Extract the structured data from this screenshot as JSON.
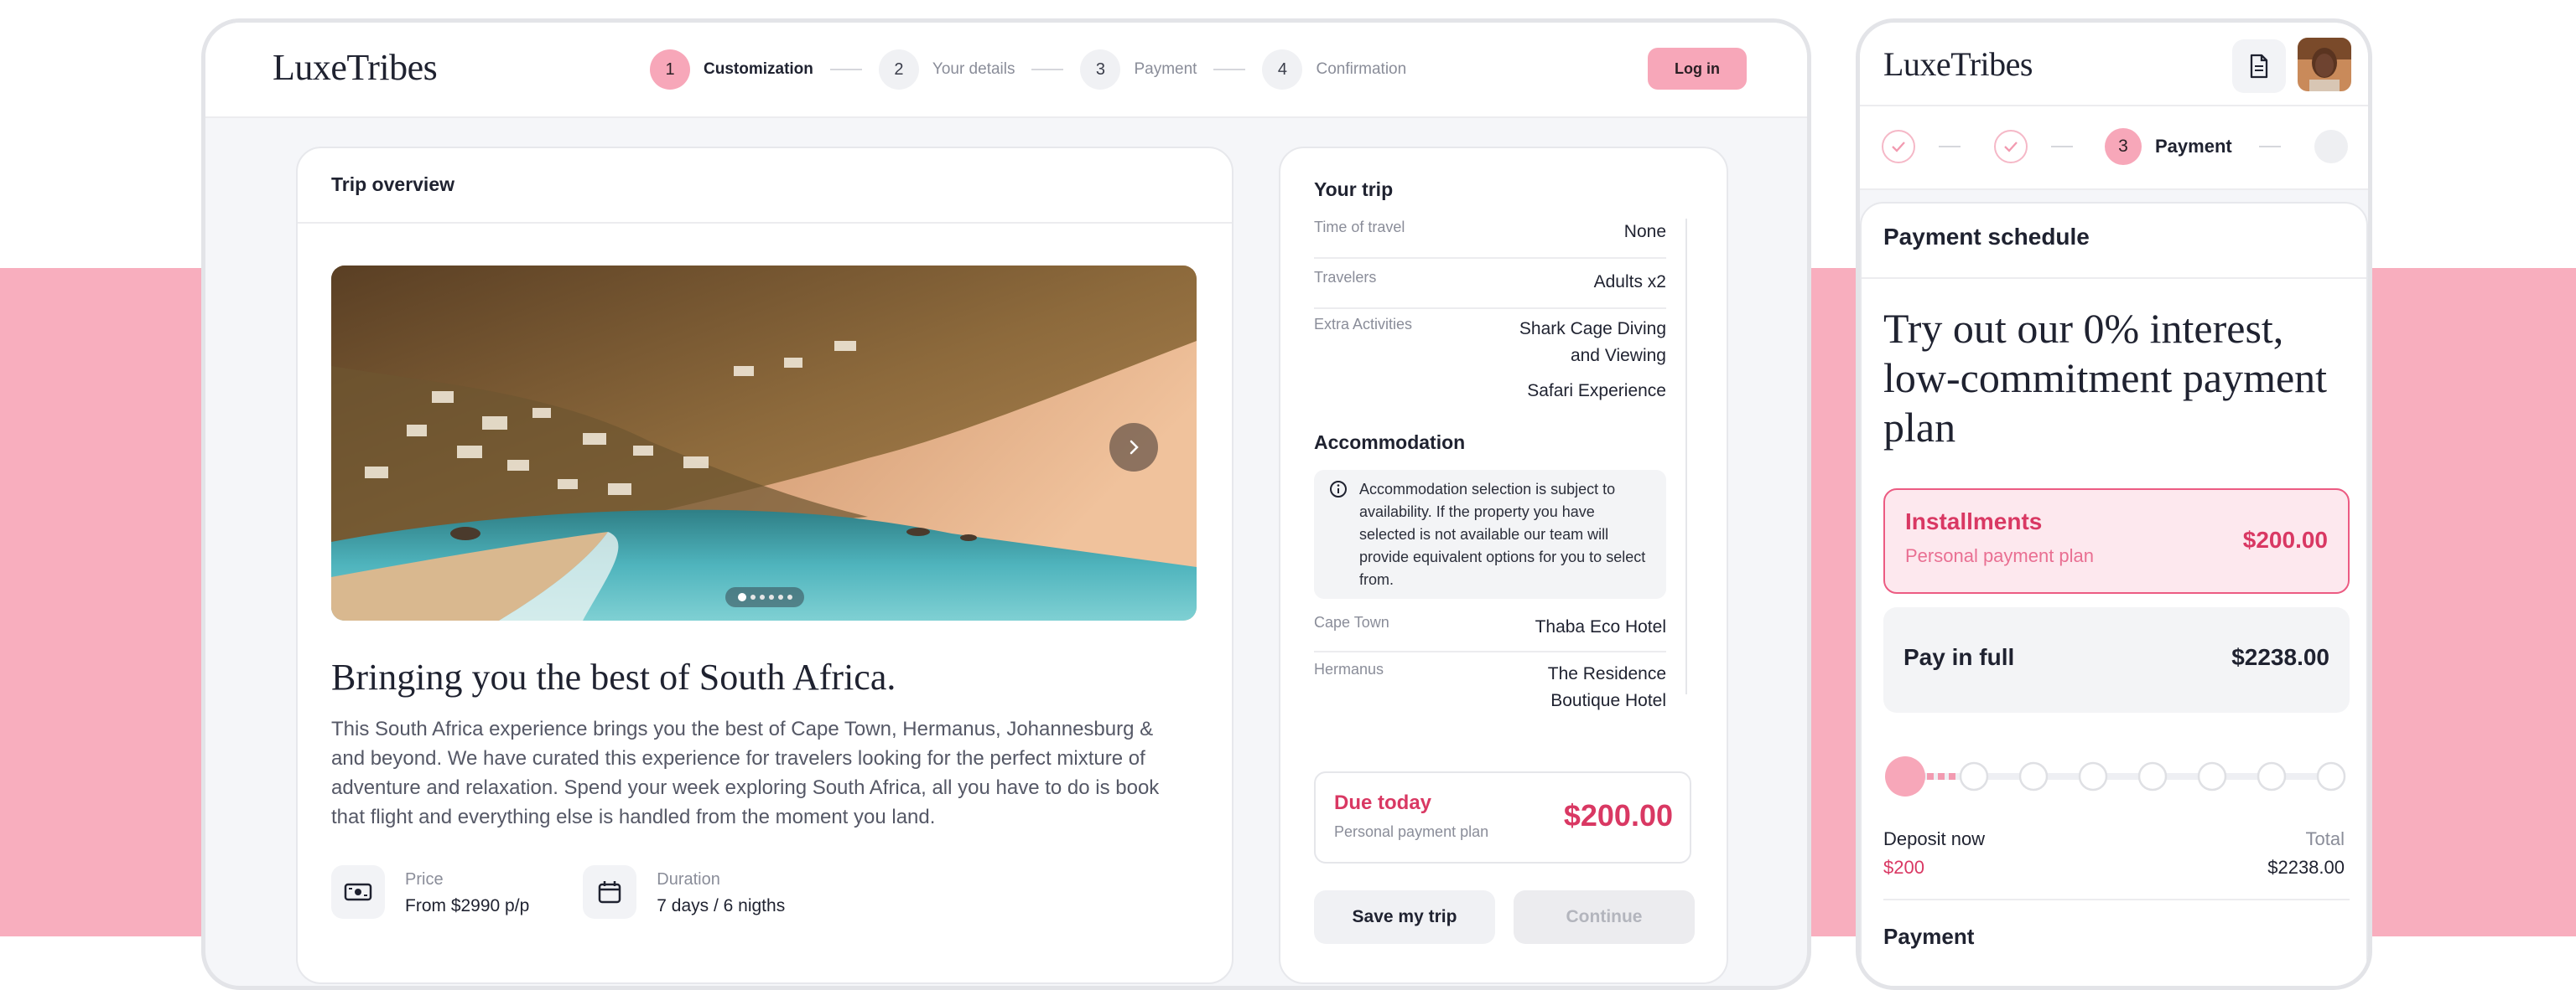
{
  "brand": {
    "name": "LuxeTribes",
    "accent": "#f7a7b9",
    "accent_strong": "#d93863",
    "page_band": "#f8aebe"
  },
  "header": {
    "steps": [
      {
        "num": "1",
        "label": "Customization",
        "active": true
      },
      {
        "num": "2",
        "label": "Your details",
        "active": false
      },
      {
        "num": "3",
        "label": "Payment",
        "active": false
      },
      {
        "num": "4",
        "label": "Confirmation",
        "active": false
      }
    ],
    "login_label": "Log in"
  },
  "overview": {
    "title": "Trip overview",
    "gallery": {
      "slide_count": 6,
      "current_slide": 1,
      "next_icon": "chevron-right-icon"
    },
    "headline": "Bringing you the best of South Africa.",
    "description": "This South Africa experience brings you the best of Cape Town, Hermanus, Johannesburg & and beyond. We have curated this experience for travelers looking for the perfect mixture of adventure and relaxation. Spend your week exploring South Africa, all you have to do is book that flight and everything else is handled from the moment you land.",
    "price": {
      "label": "Price",
      "value": "From $2990 p/p",
      "icon": "cash-icon"
    },
    "duration": {
      "label": "Duration",
      "value": "7 days / 6 nigths",
      "icon": "calendar-icon"
    }
  },
  "trip": {
    "title": "Your trip",
    "time_label": "Time of travel",
    "time_value": "None",
    "travelers_label": "Travelers",
    "travelers_value": "Adults x2",
    "extras_label": "Extra Activities",
    "extras_line1": "Shark Cage Diving",
    "extras_line2": "and Viewing",
    "extras_line3": "Safari Experience",
    "accommodation_title": "Accommodation",
    "note": "Accommodation selection is subject to availability. If the property you have selected is not available our team will provide equivalent options for you to select from.",
    "city1": "Cape Town",
    "hotel1": "Thaba Eco Hotel",
    "city2": "Hermanus",
    "hotel2_line1": "The Residence",
    "hotel2_line2": "Boutique Hotel",
    "due_label": "Due today",
    "due_sub": "Personal payment plan",
    "due_amount": "$200.00",
    "save_label": "Save my trip",
    "continue_label": "Continue"
  },
  "mobile": {
    "step_num": "3",
    "step_label": "Payment",
    "schedule_title": "Payment schedule",
    "promo_title": "Try out our 0% interest, low-commitment payment plan",
    "option_installments": {
      "name": "Installments",
      "sub": "Personal payment plan",
      "amount": "$200.00"
    },
    "option_full": {
      "name": "Pay in full",
      "amount": "$2238.00"
    },
    "installment_count": 8,
    "deposit_label": "Deposit now",
    "deposit_value": "$200",
    "total_label": "Total",
    "total_value": "$2238.00",
    "payment_heading": "Payment"
  }
}
